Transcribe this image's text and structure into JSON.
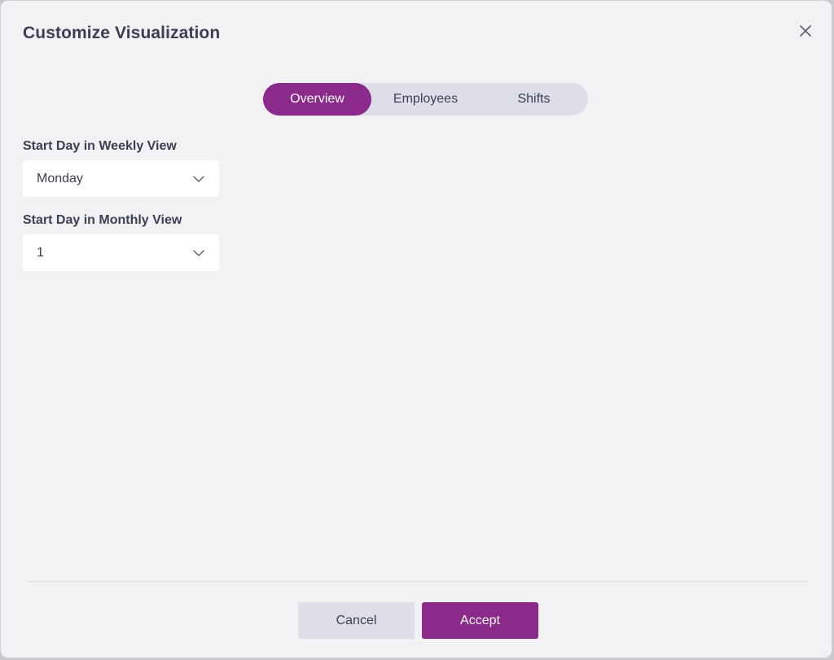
{
  "dialog": {
    "title": "Customize Visualization"
  },
  "tabs": [
    {
      "label": "Overview",
      "active": true
    },
    {
      "label": "Employees",
      "active": false
    },
    {
      "label": "Shifts",
      "active": false
    }
  ],
  "fields": {
    "weekly": {
      "label": "Start Day in Weekly View",
      "value": "Monday"
    },
    "monthly": {
      "label": "Start Day in Monthly View",
      "value": "1"
    }
  },
  "footer": {
    "cancel_label": "Cancel",
    "accept_label": "Accept"
  },
  "icons": {
    "close": "close-icon",
    "chevron": "chevron-down-icon"
  },
  "colors": {
    "accent": "#8b2a8a",
    "text": "#3b3f52",
    "background": "#f2f2f5",
    "tab_track": "#dedee9"
  }
}
